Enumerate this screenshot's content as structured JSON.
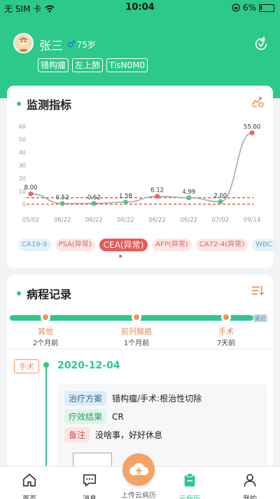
{
  "status_bar": {
    "carrier": "无 SIM 卡",
    "time": "10:04",
    "battery": "6%"
  },
  "patient": {
    "name": "张三",
    "age": "75岁",
    "tags": [
      "错构瘤",
      "左上肺",
      "TisN0M0"
    ]
  },
  "monitor": {
    "title": "监测指标",
    "chips": [
      {
        "label": "CA19-9",
        "style": "blue"
      },
      {
        "label": "PSA(异常)",
        "style": "red"
      },
      {
        "label": "CEA(异常)",
        "style": "active"
      },
      {
        "label": "AFP(异常)",
        "style": "red"
      },
      {
        "label": "CA72-4(异常)",
        "style": "red"
      },
      {
        "label": "WBC",
        "style": "blue"
      }
    ]
  },
  "chart_data": {
    "type": "line",
    "title": "",
    "xlabel": "",
    "ylabel": "",
    "x": [
      "05/02",
      "06/22",
      "06/22",
      "06/22",
      "06/22",
      "06/22",
      "07/02",
      "09/14"
    ],
    "y": [
      8.0,
      0.52,
      0.62,
      1.58,
      6.12,
      4.99,
      2.0,
      55.0
    ],
    "y_ticks": [
      0,
      10,
      20,
      30,
      40,
      50,
      60
    ],
    "ylim": [
      0,
      60
    ],
    "reference_lines": [
      0,
      5
    ],
    "grid": false,
    "colors": {
      "line": "#a8a8a8",
      "ref": "#d9443c",
      "normal": "#56c28a",
      "abnormal": "#e36b61"
    }
  },
  "history": {
    "title": "病程记录",
    "latest_label": "最近",
    "timeline": [
      {
        "label": "其他",
        "time": "2个月前"
      },
      {
        "label": "前列腺癌",
        "time": "1个月前"
      },
      {
        "label": "手术",
        "time": "7天前"
      }
    ],
    "event": {
      "tag": "手术",
      "date": "2020-12-04",
      "rows": [
        {
          "key": "治疗方案",
          "value": "错构瘤/手术:根治性切除",
          "style": "blue"
        },
        {
          "key": "疗效结果",
          "value": "CR",
          "style": "green"
        },
        {
          "key": "备注",
          "value": "没啥事，好好休息",
          "style": "pink"
        }
      ]
    }
  },
  "nav": {
    "items": [
      {
        "label": "首页",
        "icon": "home-icon"
      },
      {
        "label": "消息",
        "icon": "message-icon"
      },
      {
        "label": "云病历",
        "icon": "clipboard-icon",
        "active": true
      },
      {
        "label": "我的",
        "icon": "person-icon"
      }
    ],
    "upload_label": "上传云病历"
  }
}
